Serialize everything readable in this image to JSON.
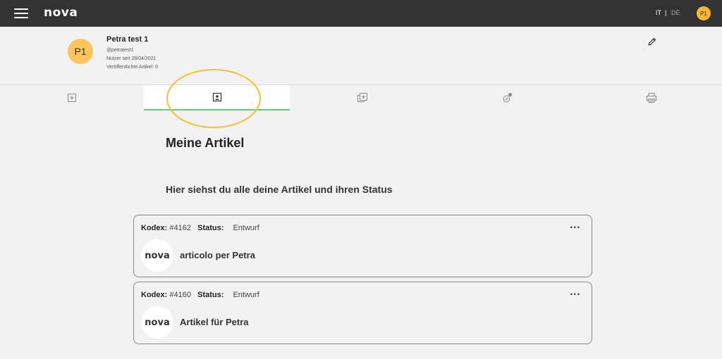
{
  "topbar": {
    "logo": "nova",
    "lang_it": "IT",
    "lang_separator": "|",
    "lang_de": "DE",
    "user_initials": "P1"
  },
  "profile": {
    "initials": "P1",
    "name": "Petra test 1",
    "handle": "@petratest1",
    "member_since": "Nutzer seit 28/04/2021",
    "published_count": "Veröffentlichte Artikel: 0"
  },
  "tabs": [
    {
      "icon": "plus-square-icon",
      "active": false
    },
    {
      "icon": "user-profile-icon",
      "active": true
    },
    {
      "icon": "stacked-add-icon",
      "active": false
    },
    {
      "icon": "badge-hand-icon",
      "active": false
    },
    {
      "icon": "printer-icon",
      "active": false
    }
  ],
  "main": {
    "title": "Meine Artikel",
    "subtitle": "Hier siehst du alle deine Artikel und ihren Status"
  },
  "articles": [
    {
      "code_label": "Kodex:",
      "code": "#4162",
      "status_label": "Status:",
      "status": "Entwurf",
      "logo": "nova",
      "title": "articolo per Petra",
      "menu": "···"
    },
    {
      "code_label": "Kodex:",
      "code": "#4160",
      "status_label": "Status:",
      "status": "Entwurf",
      "logo": "nova",
      "title": "Artikel für Petra",
      "menu": "···"
    }
  ],
  "colors": {
    "topbar": "#333333",
    "background": "#f2f2f2",
    "avatar": "#fdc45a",
    "active_tab_underline": "#5ccf7d",
    "highlight_ring": "#f6c12a"
  }
}
